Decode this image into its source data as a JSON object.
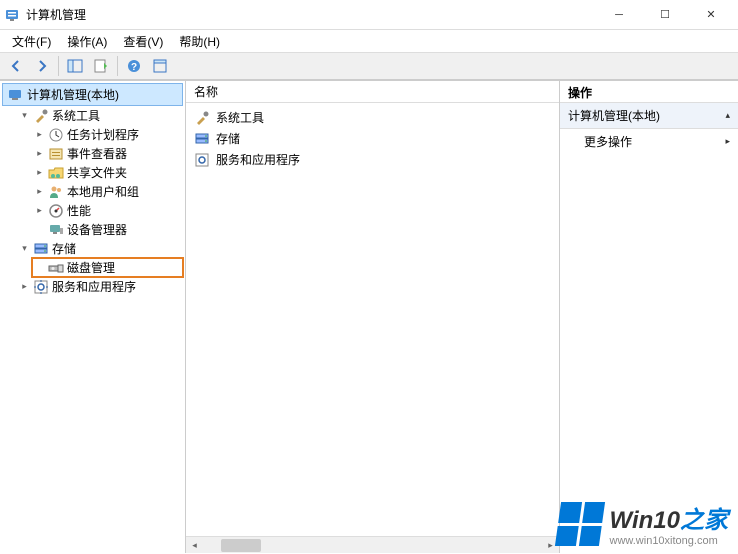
{
  "window": {
    "title": "计算机管理"
  },
  "menu": {
    "file": "文件(F)",
    "action": "操作(A)",
    "view": "查看(V)",
    "help": "帮助(H)"
  },
  "tree": {
    "root": "计算机管理(本地)",
    "system_tools": "系统工具",
    "task_scheduler": "任务计划程序",
    "event_viewer": "事件查看器",
    "shared_folders": "共享文件夹",
    "local_users": "本地用户和组",
    "performance": "性能",
    "device_manager": "设备管理器",
    "storage": "存储",
    "disk_management": "磁盘管理",
    "services_apps": "服务和应用程序"
  },
  "middle": {
    "header": "名称",
    "items": {
      "system_tools": "系统工具",
      "storage": "存储",
      "services_apps": "服务和应用程序"
    }
  },
  "actions": {
    "header": "操作",
    "subheader": "计算机管理(本地)",
    "more": "更多操作"
  },
  "watermark": {
    "brand_main": "Win10",
    "brand_suffix": "之家",
    "url": "www.win10xitong.com"
  }
}
